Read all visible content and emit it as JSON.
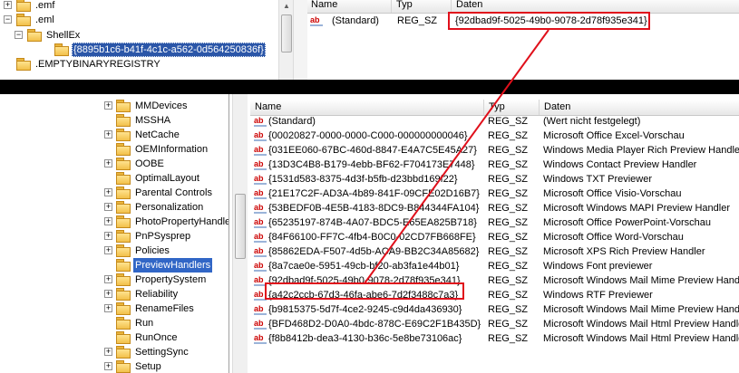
{
  "top": {
    "tree": [
      {
        "label": ".emf",
        "expander": "+"
      },
      {
        "label": ".eml",
        "expander": "−"
      },
      {
        "label": "ShellEx",
        "expander": "−"
      },
      {
        "label": "{8895b1c6-b41f-4c1c-a562-0d564250836f}",
        "expander": ""
      },
      {
        "label": ".EMPTYBINARYREGISTRY",
        "expander": ""
      }
    ],
    "columns": {
      "name": "Name",
      "type": "Typ",
      "data": "Daten"
    },
    "row": {
      "icon": "ab",
      "name": "(Standard)",
      "type": "REG_SZ",
      "data": "{92dbad9f-5025-49b0-9078-2d78f935e341}"
    }
  },
  "bottom": {
    "tree": [
      {
        "label": "MMDevices",
        "expander": "+"
      },
      {
        "label": "MSSHA",
        "expander": ""
      },
      {
        "label": "NetCache",
        "expander": "+"
      },
      {
        "label": "OEMInformation",
        "expander": ""
      },
      {
        "label": "OOBE",
        "expander": "+"
      },
      {
        "label": "OptimalLayout",
        "expander": ""
      },
      {
        "label": "Parental Controls",
        "expander": "+"
      },
      {
        "label": "Personalization",
        "expander": "+"
      },
      {
        "label": "PhotoPropertyHandle",
        "expander": "+"
      },
      {
        "label": "PnPSysprep",
        "expander": "+"
      },
      {
        "label": "Policies",
        "expander": "+"
      },
      {
        "label": "PreviewHandlers",
        "expander": ""
      },
      {
        "label": "PropertySystem",
        "expander": "+"
      },
      {
        "label": "Reliability",
        "expander": "+"
      },
      {
        "label": "RenameFiles",
        "expander": "+"
      },
      {
        "label": "Run",
        "expander": ""
      },
      {
        "label": "RunOnce",
        "expander": ""
      },
      {
        "label": "SettingSync",
        "expander": "+"
      },
      {
        "label": "Setup",
        "expander": "+"
      }
    ],
    "columns": {
      "name": "Name",
      "type": "Typ",
      "data": "Daten"
    },
    "rows": [
      {
        "icon": "ab",
        "name": "(Standard)",
        "type": "REG_SZ",
        "data": "(Wert nicht festgelegt)"
      },
      {
        "icon": "ab",
        "name": "{00020827-0000-0000-C000-000000000046}",
        "type": "REG_SZ",
        "data": "Microsoft Office Excel-Vorschau"
      },
      {
        "icon": "ab",
        "name": "{031EE060-67BC-460d-8847-E4A7C5E45A27}",
        "type": "REG_SZ",
        "data": "Windows Media Player Rich Preview Handler"
      },
      {
        "icon": "ab",
        "name": "{13D3C4B8-B179-4ebb-BF62-F704173E7448}",
        "type": "REG_SZ",
        "data": "Windows Contact Preview Handler"
      },
      {
        "icon": "ab",
        "name": "{1531d583-8375-4d3f-b5fb-d23bbd169f22}",
        "type": "REG_SZ",
        "data": "Windows TXT Previewer"
      },
      {
        "icon": "ab",
        "name": "{21E17C2F-AD3A-4b89-841F-09CFE02D16B7}",
        "type": "REG_SZ",
        "data": "Microsoft Office Visio-Vorschau"
      },
      {
        "icon": "ab",
        "name": "{53BEDF0B-4E5B-4183-8DC9-B844344FA104}",
        "type": "REG_SZ",
        "data": "Microsoft Windows MAPI Preview Handler"
      },
      {
        "icon": "ab",
        "name": "{65235197-874B-4A07-BDC5-E65EA825B718}",
        "type": "REG_SZ",
        "data": "Microsoft Office PowerPoint-Vorschau"
      },
      {
        "icon": "ab",
        "name": "{84F66100-FF7C-4fb4-B0C0-02CD7FB668FE}",
        "type": "REG_SZ",
        "data": "Microsoft Office Word-Vorschau"
      },
      {
        "icon": "ab",
        "name": "{85862EDA-F507-4d5b-ACA9-BB2C34A85682}",
        "type": "REG_SZ",
        "data": "Microsoft XPS Rich Preview Handler"
      },
      {
        "icon": "ab",
        "name": "{8a7cae0e-5951-49cb-bf20-ab3fa1e44b01}",
        "type": "REG_SZ",
        "data": "Windows Font previewer"
      },
      {
        "icon": "ab",
        "name": "{92dbad9f-5025-49b0-9078-2d78f935e341}",
        "type": "REG_SZ",
        "data": "Microsoft Windows Mail Mime Preview Handler"
      },
      {
        "icon": "ab",
        "name": "{a42c2ccb-67d3-46fa-abe6-7d2f3488c7a3}",
        "type": "REG_SZ",
        "data": "Windows RTF Previewer"
      },
      {
        "icon": "ab",
        "name": "{b9815375-5d7f-4ce2-9245-c9d4da436930}",
        "type": "REG_SZ",
        "data": "Microsoft Windows Mail Mime Preview Handler"
      },
      {
        "icon": "ab",
        "name": "{BFD468D2-D0A0-4bdc-878C-E69C2F1B435D}",
        "type": "REG_SZ",
        "data": "Microsoft Windows Mail Html Preview Handler"
      },
      {
        "icon": "ab",
        "name": "{f8b8412b-dea3-4130-b36c-5e8be73106ac}",
        "type": "REG_SZ",
        "data": "Microsoft Windows Mail Html Preview Handler"
      }
    ]
  },
  "colors": {
    "highlight_box": "#e0101b",
    "selection": "#3166c6",
    "divider_bar": "#000000"
  }
}
